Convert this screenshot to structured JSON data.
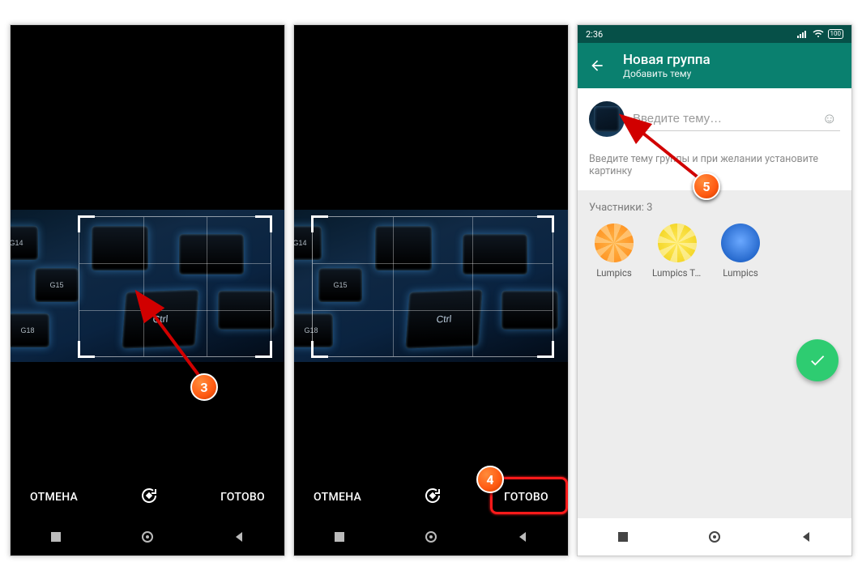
{
  "crop": {
    "cancel_label": "ОТМЕНА",
    "done_label": "ГОТОВО",
    "key_labels": {
      "g14": "G14",
      "g15": "G15",
      "g18": "G18",
      "ctrl": "Ctrl"
    }
  },
  "whatsapp": {
    "status_time": "2:36",
    "battery_pct": "100",
    "header_title": "Новая группа",
    "header_subtitle": "Добавить тему",
    "topic_placeholder": "Введите тему…",
    "help_text": "Введите тему группы и при желании установите картинку",
    "participants_label": "Участники: 3",
    "participants": [
      {
        "name": "Lumpics",
        "style": "orange-slice"
      },
      {
        "name": "Lumpics Te…",
        "style": "lemon-slice"
      },
      {
        "name": "Lumpics",
        "style": "book"
      }
    ]
  },
  "markers": {
    "m3": "3",
    "m4": "4",
    "m5": "5"
  }
}
